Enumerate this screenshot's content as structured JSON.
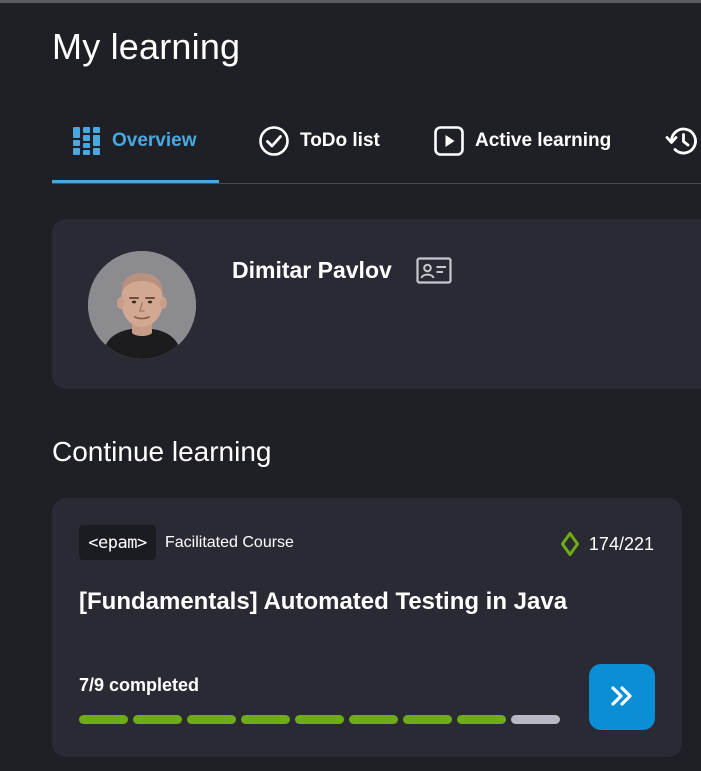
{
  "page": {
    "title": "My learning"
  },
  "tabs": [
    {
      "label": "Overview",
      "icon": "grid-icon",
      "active": true
    },
    {
      "label": "ToDo list",
      "icon": "check-circle-icon",
      "active": false
    },
    {
      "label": "Active learning",
      "icon": "play-icon",
      "active": false
    },
    {
      "label": "",
      "icon": "history-icon",
      "active": false
    }
  ],
  "profile": {
    "name": "Dimitar Pavlov",
    "icon": "id-card-icon"
  },
  "continue_learning": {
    "title": "Continue learning",
    "course": {
      "provider": "<epam>",
      "type": "Facilitated Course",
      "points": "174/221",
      "points_icon": "gem-icon",
      "title": "[Fundamentals] Automated Testing in Java",
      "progress_text": "7/9 completed",
      "progress": {
        "completed": 8,
        "total": 9
      },
      "button_icon": "double-chevron-right-icon"
    }
  },
  "colors": {
    "background": "#1f1f26",
    "card": "#2a2a34",
    "accent": "#4aa8e0",
    "progress": "#6eab14",
    "progress_incomplete": "#b6b8c6",
    "button": "#0a8ed6",
    "gem": "#6eab14"
  }
}
